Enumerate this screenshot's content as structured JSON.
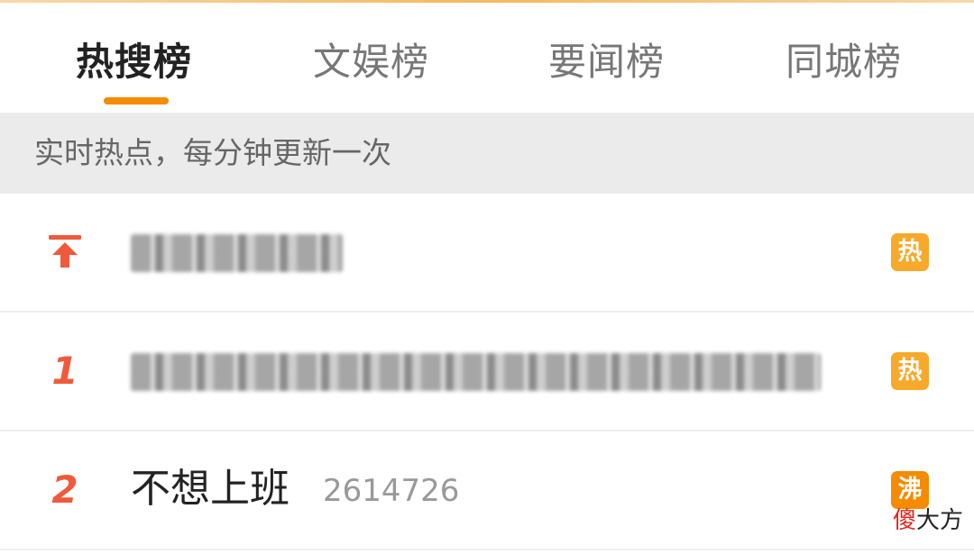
{
  "tabs": [
    {
      "label": "热搜榜",
      "active": true
    },
    {
      "label": "文娱榜",
      "active": false
    },
    {
      "label": "要闻榜",
      "active": false
    },
    {
      "label": "同城榜",
      "active": false
    }
  ],
  "accent_color": "#f58b00",
  "subheader": {
    "text": "实时热点，每分钟更新一次"
  },
  "rows": [
    {
      "rank_icon": "pin-top-icon",
      "title": "(blurred)",
      "badge": {
        "label": "热",
        "color": "#f7a92b"
      }
    },
    {
      "rank": "1",
      "title": "(blurred)",
      "badge": {
        "label": "热",
        "color": "#f7a92b"
      }
    },
    {
      "rank": "2",
      "title": "不想上班",
      "count": "2614726",
      "badge": {
        "label": "沸",
        "color": "#f58b00"
      }
    }
  ],
  "watermark": {
    "first": "傻",
    "rest": "大方"
  }
}
